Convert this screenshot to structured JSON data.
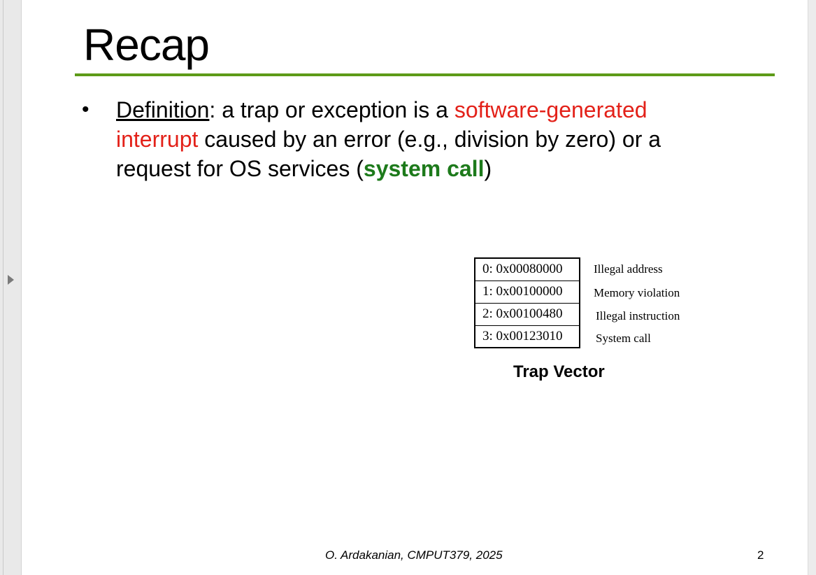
{
  "slide": {
    "title": "Recap",
    "bullet": {
      "term": "Definition",
      "text_1": ": a trap or exception is a ",
      "highlight_red": "software-generated interrupt",
      "text_2": " caused by an error (e.g., division by zero) or a request for OS services (",
      "highlight_green": "system call",
      "text_3": ")"
    },
    "trap_vector": {
      "caption": "Trap Vector",
      "entries": [
        {
          "address": "0: 0x00080000",
          "label": "Illegal address"
        },
        {
          "address": "1: 0x00100000",
          "label": "Memory violation"
        },
        {
          "address": "2: 0x00100480",
          "label": "Illegal instruction"
        },
        {
          "address": "3: 0x00123010",
          "label": "System call"
        }
      ]
    },
    "footer": "O. Ardakanian, CMPUT379, 2025",
    "page_number": "2"
  },
  "colors": {
    "rule": "#5d9b18",
    "red": "#e32119",
    "green": "#1d7a1b"
  },
  "icons": {
    "expand": "triangle-right-icon"
  }
}
